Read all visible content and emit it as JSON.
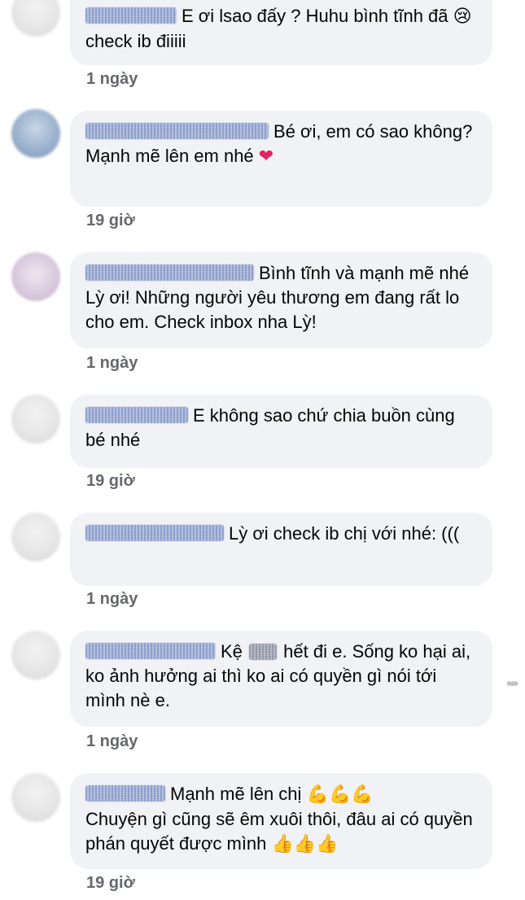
{
  "comments": [
    {
      "text_before": "E ơi lsao đấy ? Huhu bình tĩnh đã",
      "emoji": "😢",
      "text_after": "check ib điiiii",
      "time": "1 ngày"
    },
    {
      "text": "Bé ơi, em có sao không?",
      "text2": "Mạnh mẽ lên em nhé",
      "emoji": "❤",
      "time": "19 giờ"
    },
    {
      "text": "Bình tĩnh và mạnh mẽ nhé Lỳ ơi! Những người yêu thương em đang rất lo cho em. Check inbox nha Lỳ!",
      "time": "1 ngày"
    },
    {
      "text": "E không sao chứ chia buồn cùng bé nhé",
      "time": "19 giờ"
    },
    {
      "text": "Lỳ ơi check ib chị với nhé: (((",
      "time": "1 ngày"
    },
    {
      "text_before": "Kệ",
      "text_after": "hết đi e. Sống ko hại ai, ko ảnh hưởng ai thì ko ai có quyền gì nói tới mình nè e.",
      "time": "1 ngày"
    },
    {
      "text": "Mạnh mẽ lên chị",
      "emoji1": "💪💪💪",
      "text2": "Chuyện gì cũng sẽ êm xuôi thôi, đâu ai có quyền phán quyết được mình",
      "emoji2": "👍👍👍",
      "time": "19 giờ"
    }
  ],
  "more_icon": "more-options-icon",
  "more_label": "•••"
}
